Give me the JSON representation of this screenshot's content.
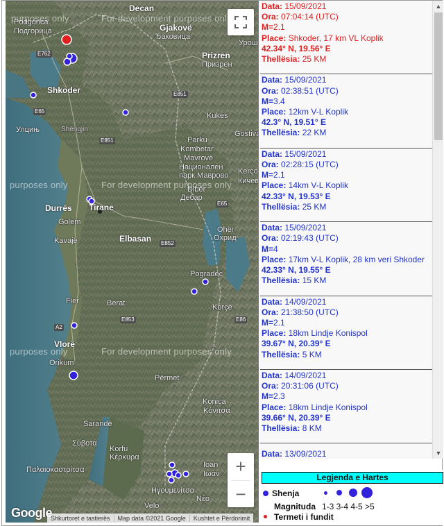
{
  "map": {
    "dev_text": "For development purposes only",
    "dev_text_fragment": "purposes only",
    "places": {
      "podgorica_lat": "Podgorica",
      "podgorica_cyr": "Подгорица",
      "decan": "Decan",
      "gjakove": "Gjakovë",
      "gjakove_cyr": "Ђаковица",
      "prizren": "Prizren",
      "prizren_cyr": "Призрен",
      "urosh": "Урош",
      "shkoder": "Shkoder",
      "shkoder_cyr": "Улцињ",
      "shengjin": "Shëngjin",
      "kukes": "Kukës",
      "gostivar": "Gostiva",
      "kercove": "Kerçov",
      "kercove_cyr": "Кичев",
      "mavrove": "Mavrovë",
      "mavrove_cyr": "Маврово",
      "parku": "Parku",
      "kombetar": "Kombetar",
      "nacionalen": "Национален",
      "park_mavrovo": "парк Маврово",
      "dibra": "Dibër",
      "debar": "Дебар",
      "durres": "Durrës",
      "tirane": "Tirane",
      "golem": "Golem",
      "kavaje": "Kavajë",
      "elbasan": "Elbasan",
      "ohrid": "Ohër",
      "ohrid_cyr": "Охрид",
      "pogradec": "Pogradec",
      "fier": "Fier",
      "berat": "Berat",
      "korce": "Korçë",
      "vlore": "Vlorë",
      "orikum": "Orikum",
      "permet": "Përmet",
      "konica": "Konica",
      "konitsa": "Κόνιτσα",
      "sarande": "Sarandë",
      "sivota": "Σύβοτα",
      "korfu": "Korfu",
      "kerkyra": "Κέρκυρα",
      "palaiokastritsa": "Παλαιοκαστρίτσα",
      "ioannina": "Ioan",
      "ioannina_gr": "Ιωάν",
      "igoumenitsa": "Ηγουμενίτσα",
      "velo": "Velo",
      "neo": "Νέο"
    },
    "roads": [
      "E762",
      "E851",
      "E65",
      "E851",
      "E852",
      "E65",
      "A2",
      "E853",
      "E86"
    ],
    "attribution": [
      "Shkurtoret e tastierës",
      "Map data ©2021 Google",
      "Kushtet e Përdorimit"
    ],
    "google_logo": "Google",
    "fullscreen_icon": "fullscreen-icon",
    "zoom_in_label": "+",
    "zoom_out_label": "−"
  },
  "earthquakes": [
    {
      "data_label": "Data:",
      "data": "15/09/2021",
      "ora_label": "Ora:",
      "ora": "07:04:14 (UTC)",
      "m_label": "M=",
      "m": "2.1",
      "place_label": "Place:",
      "place": "Shkoder, 17 km VL Koplik",
      "coord": "42.34° N, 19.56° E",
      "depth_label": "Thellësia:",
      "depth": "25 KM",
      "latest": true
    },
    {
      "data_label": "Data:",
      "data": "15/09/2021",
      "ora_label": "Ora:",
      "ora": "02:38:51 (UTC)",
      "m_label": "M=",
      "m": "3.4",
      "place_label": "Place:",
      "place": "12km V-L Koplik",
      "coord": "42.3° N, 19.51° E",
      "depth_label": "Thellësia:",
      "depth": "22 KM",
      "latest": false
    },
    {
      "data_label": "Data:",
      "data": "15/09/2021",
      "ora_label": "Ora:",
      "ora": "02:28:15 (UTC)",
      "m_label": "M=",
      "m": "2.1",
      "place_label": "Place:",
      "place": "14km V-L Koplik",
      "coord": "42.33° N, 19.53° E",
      "depth_label": "Thellësia:",
      "depth": "25 KM",
      "latest": false
    },
    {
      "data_label": "Data:",
      "data": "15/09/2021",
      "ora_label": "Ora:",
      "ora": "02:19:43 (UTC)",
      "m_label": "M=",
      "m": "4",
      "place_label": "Place:",
      "place": "17km V-L Koplik, 28 km veri Shkoder",
      "coord": "42.33° N, 19.55° E",
      "depth_label": "Thellësia:",
      "depth": "15 KM",
      "latest": false
    },
    {
      "data_label": "Data:",
      "data": "14/09/2021",
      "ora_label": "Ora:",
      "ora": "21:38:50 (UTC)",
      "m_label": "M=",
      "m": "2.1",
      "place_label": "Place:",
      "place": "18km Lindje Konispol",
      "coord": "39.67° N, 20.39° E",
      "depth_label": "Thellësia:",
      "depth": "5 KM",
      "latest": false
    },
    {
      "data_label": "Data:",
      "data": "14/09/2021",
      "ora_label": "Ora:",
      "ora": "20:31:06 (UTC)",
      "m_label": "M=",
      "m": "2.3",
      "place_label": "Place:",
      "place": "18km Lindje Konispol",
      "coord": "39.66° N, 20.39° E",
      "depth_label": "Thellësia:",
      "depth": "8 KM",
      "latest": false
    }
  ],
  "partial_entry": {
    "data_label": "Data:",
    "data": "13/09/2021"
  },
  "legend": {
    "title": "Legjenda e Hartes",
    "shenja": "Shenja",
    "magnituda": "Magnituda",
    "ranges": "1-3 3-4 4-5 >5",
    "latest": "Termeti i fundit",
    "marker_color": "#3322dd",
    "latest_color": "#e02020"
  }
}
